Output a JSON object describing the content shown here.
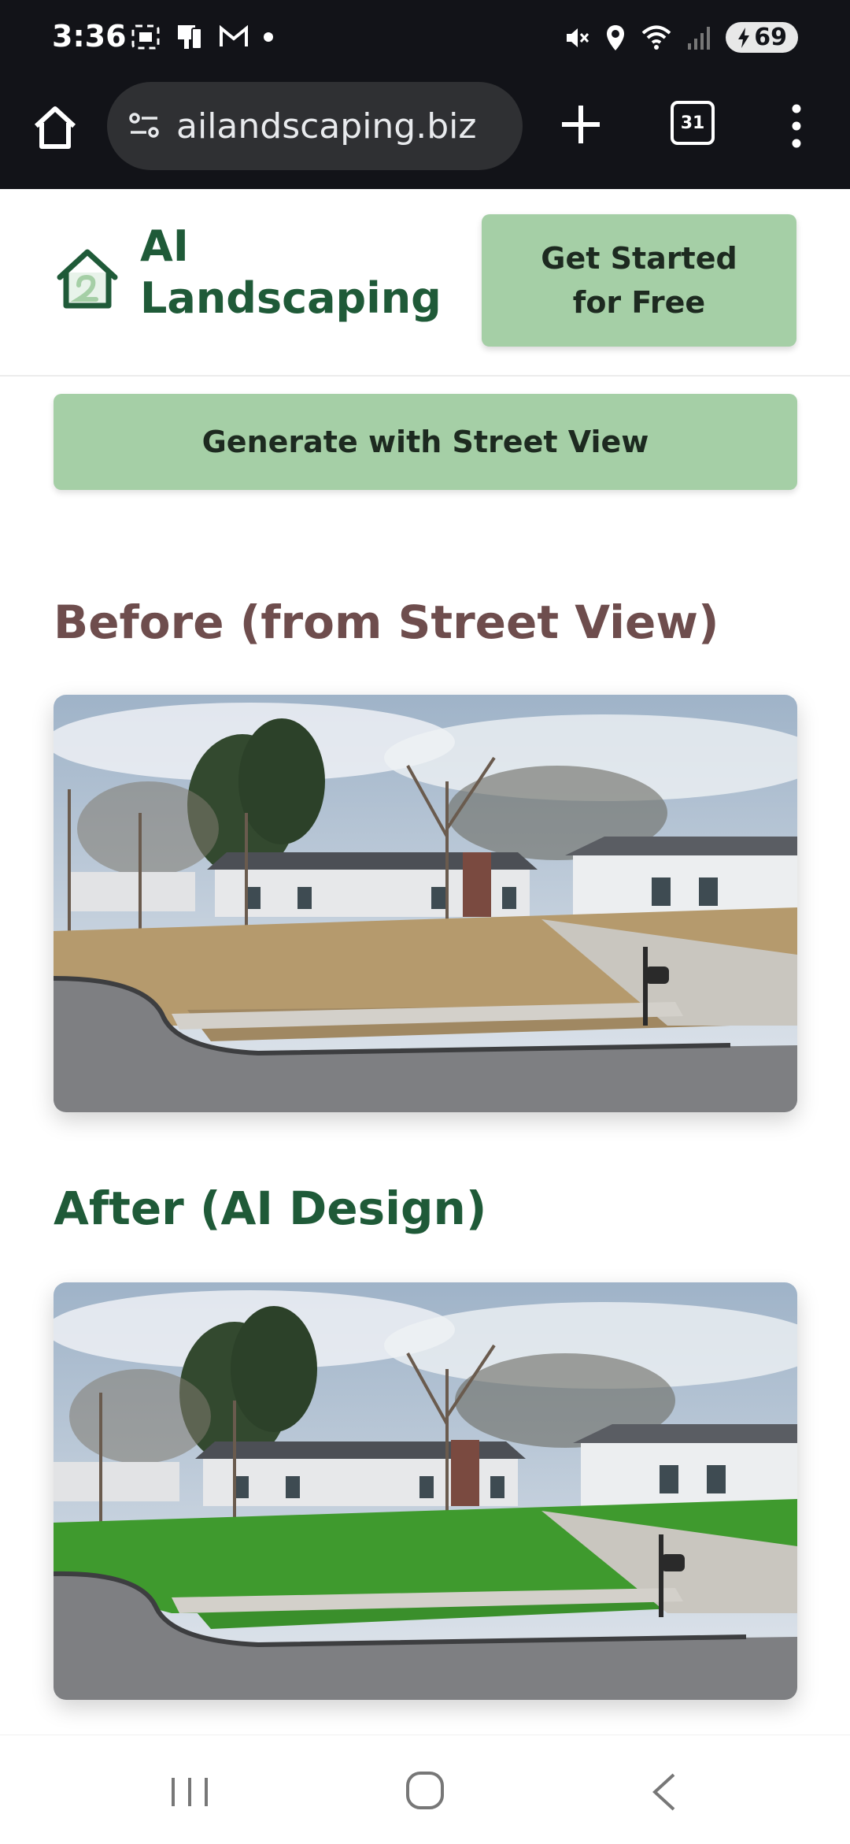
{
  "status_bar": {
    "time": "3:36",
    "battery": "69",
    "left_icons": [
      "screenshot-icon",
      "device-icon",
      "gmail-icon",
      "dot-icon"
    ],
    "right_icons": [
      "mute-icon",
      "location-icon",
      "wifi-icon",
      "signal-icon",
      "battery-icon"
    ]
  },
  "browser": {
    "url": "ailandscaping.biz",
    "tab_count": "31"
  },
  "header": {
    "brand_line1": "AI",
    "brand_line2": "Landscaping",
    "cta_label": "Get Started for Free"
  },
  "main": {
    "street_view_button": "Generate with Street View",
    "before_title": "Before (from Street View)",
    "after_title": "After (AI Design)"
  },
  "colors": {
    "brand_green": "#1f5a38",
    "button_green": "#a5cfa6",
    "before_title": "#6e4d4d",
    "browser_dark": "#121318"
  }
}
